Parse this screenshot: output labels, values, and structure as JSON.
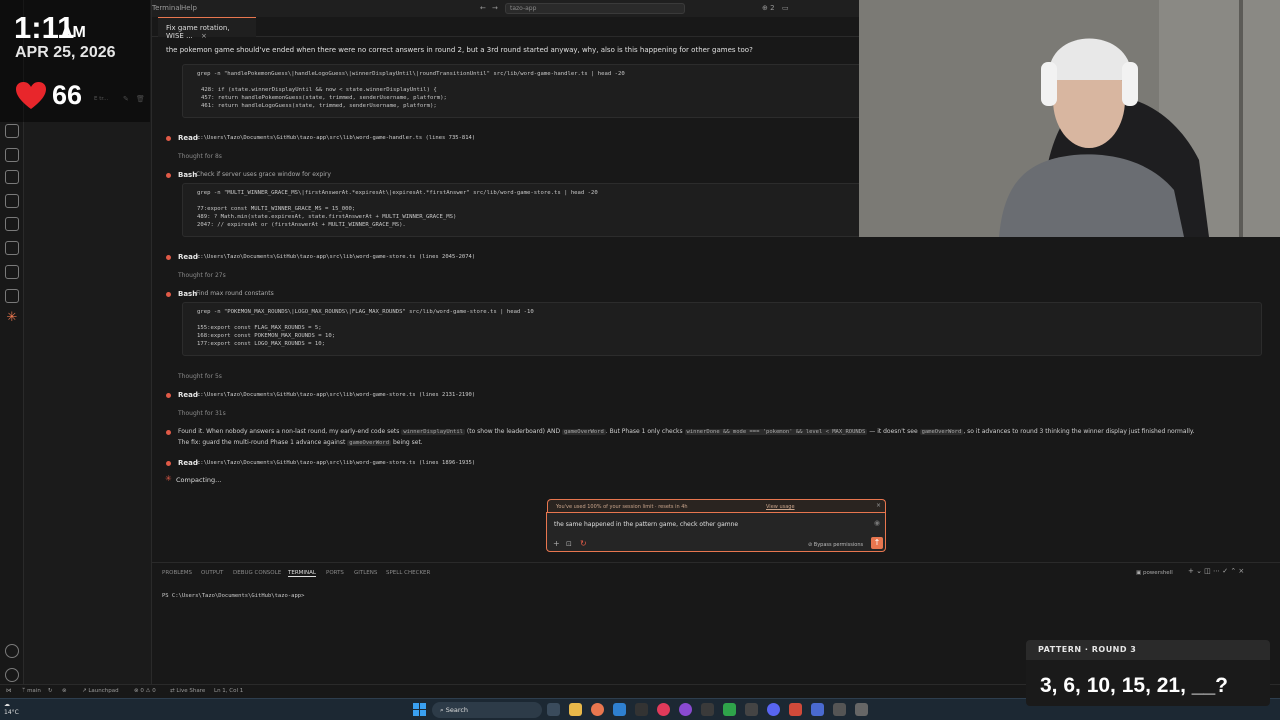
{
  "menu": {
    "terminal": "Terminal",
    "help": "Help",
    "search": "tazo-app"
  },
  "tab": {
    "title": "Fix game rotation, WISE ...",
    "close": "×"
  },
  "sidebar": {
    "item_suffix": "E tr..."
  },
  "chat": {
    "user_message": "the pokemon game should've ended when there were no correct answers in round 2, but a 3rd round started anyway, why, also is this happening for other games too?",
    "block1": {
      "command": "grep -n \"handlePokemonGuess\\|handleLogoGuess\\|winnerDisplayUntil\\|roundTransitionUntil\" src/lib/word-game-handler.ts | head -20",
      "lines": [
        "428:  if (state.winnerDisplayUntil && now < state.winnerDisplayUntil) {",
        "457:    return handlePokemonGuess(state, trimmed, senderUsername, platform);",
        "461:    return handleLogoGuess(state, trimmed, senderUsername, platform);"
      ]
    },
    "read1": {
      "label": "Read",
      "path": "c:\\Users\\Tazo\\Documents\\GitHub\\tazo-app\\src\\lib\\word-game-handler.ts (lines 735-814)"
    },
    "thought1": "Thought for 8s",
    "bash1": {
      "label": "Bash",
      "desc": "Check if server uses grace window for expiry",
      "command": "grep -n \"MULTI_WINNER_GRACE_MS\\|firstAnswerAt.*expiresAt\\|expiresAt.*firstAnswer\" src/lib/word-game-store.ts | head -20",
      "lines": [
        "77:export const MULTI_WINNER_GRACE_MS = 15_000;",
        "489:    ? Math.min(state.expiresAt, state.firstAnswerAt + MULTI_WINNER_GRACE_MS)",
        "2047:  // expiresAt or (firstAnswerAt + MULTI_WINNER_GRACE_MS)."
      ]
    },
    "read2": {
      "label": "Read",
      "path": "c:\\Users\\Tazo\\Documents\\GitHub\\tazo-app\\src\\lib\\word-game-store.ts (lines 2045-2074)"
    },
    "thought2": "Thought for 27s",
    "bash2": {
      "label": "Bash",
      "desc": "Find max round constants",
      "command": "grep -n \"POKEMON_MAX_ROUNDS\\|LOGO_MAX_ROUNDS\\|FLAG_MAX_ROUNDS\" src/lib/word-game-store.ts | head -10",
      "lines": [
        "155:export const FLAG_MAX_ROUNDS = 5;",
        "168:export const POKEMON_MAX_ROUNDS = 10;",
        "177:export const LOGO_MAX_ROUNDS      = 10;"
      ]
    },
    "thought3": "Thought for 5s",
    "read3": {
      "label": "Read",
      "path": "c:\\Users\\Tazo\\Documents\\GitHub\\tazo-app\\src\\lib\\word-game-store.ts (lines 2131-2190)"
    },
    "thought4": "Thought for 31s",
    "found": {
      "p1": "Found it. When nobody answers a non-last round, my early-end code sets",
      "c1": "winnerDisplayUntil",
      "p2": "(to show the leaderboard) AND",
      "c2": "gameOverWord",
      "p3": ". But Phase 1 only checks",
      "c3": "winnerDone && mode === 'pokemon' && level < MAX_ROUNDS",
      "p4": "— it doesn't see",
      "c4": "gameOverWord",
      "p5": ", so it advances to round 3 thinking the winner display just finished normally.",
      "p6": "The fix: guard the multi-round Phase 1 advance against",
      "c5": "gameOverWord",
      "p7": "being set."
    },
    "read4": {
      "label": "Read",
      "path": "c:\\Users\\Tazo\\Documents\\GitHub\\tazo-app\\src\\lib\\word-game-store.ts (lines 1896-1935)"
    },
    "compacting": "Compacting..."
  },
  "input": {
    "limit_text": "You've used 100% of your session limit · resets in 4h",
    "view_usage": "View usage",
    "value": "the same happened in the pattern game, check other gamne",
    "bypass": "Bypass permissions"
  },
  "panel": {
    "tabs": [
      "PROBLEMS",
      "OUTPUT",
      "DEBUG CONSOLE",
      "TERMINAL",
      "PORTS",
      "GITLENS",
      "SPELL CHECKER"
    ],
    "active_tab": "TERMINAL",
    "shell": "powershell",
    "prompt": "PS C:\\Users\\Tazo\\Documents\\GitHub\\tazo-app>"
  },
  "status": {
    "branch": "main",
    "launchpad": "Launchpad",
    "errors": "0",
    "warnings": "0",
    "liveshare": "Live Share",
    "position": "Ln 1, Col 1"
  },
  "overlay": {
    "time": "1:11",
    "ampm": "AM",
    "date": "APR 25, 2026",
    "heart_rate": "66",
    "pattern_title": "PATTERN · ROUND 3",
    "pattern_seq": "3, 6, 10, 15, 21, __?"
  },
  "taskbar": {
    "search": "Search",
    "weather": "14°C"
  },
  "colors": {
    "accent": "#e8764f",
    "dot_red": "#e05a47",
    "heart": "#e8262b"
  }
}
